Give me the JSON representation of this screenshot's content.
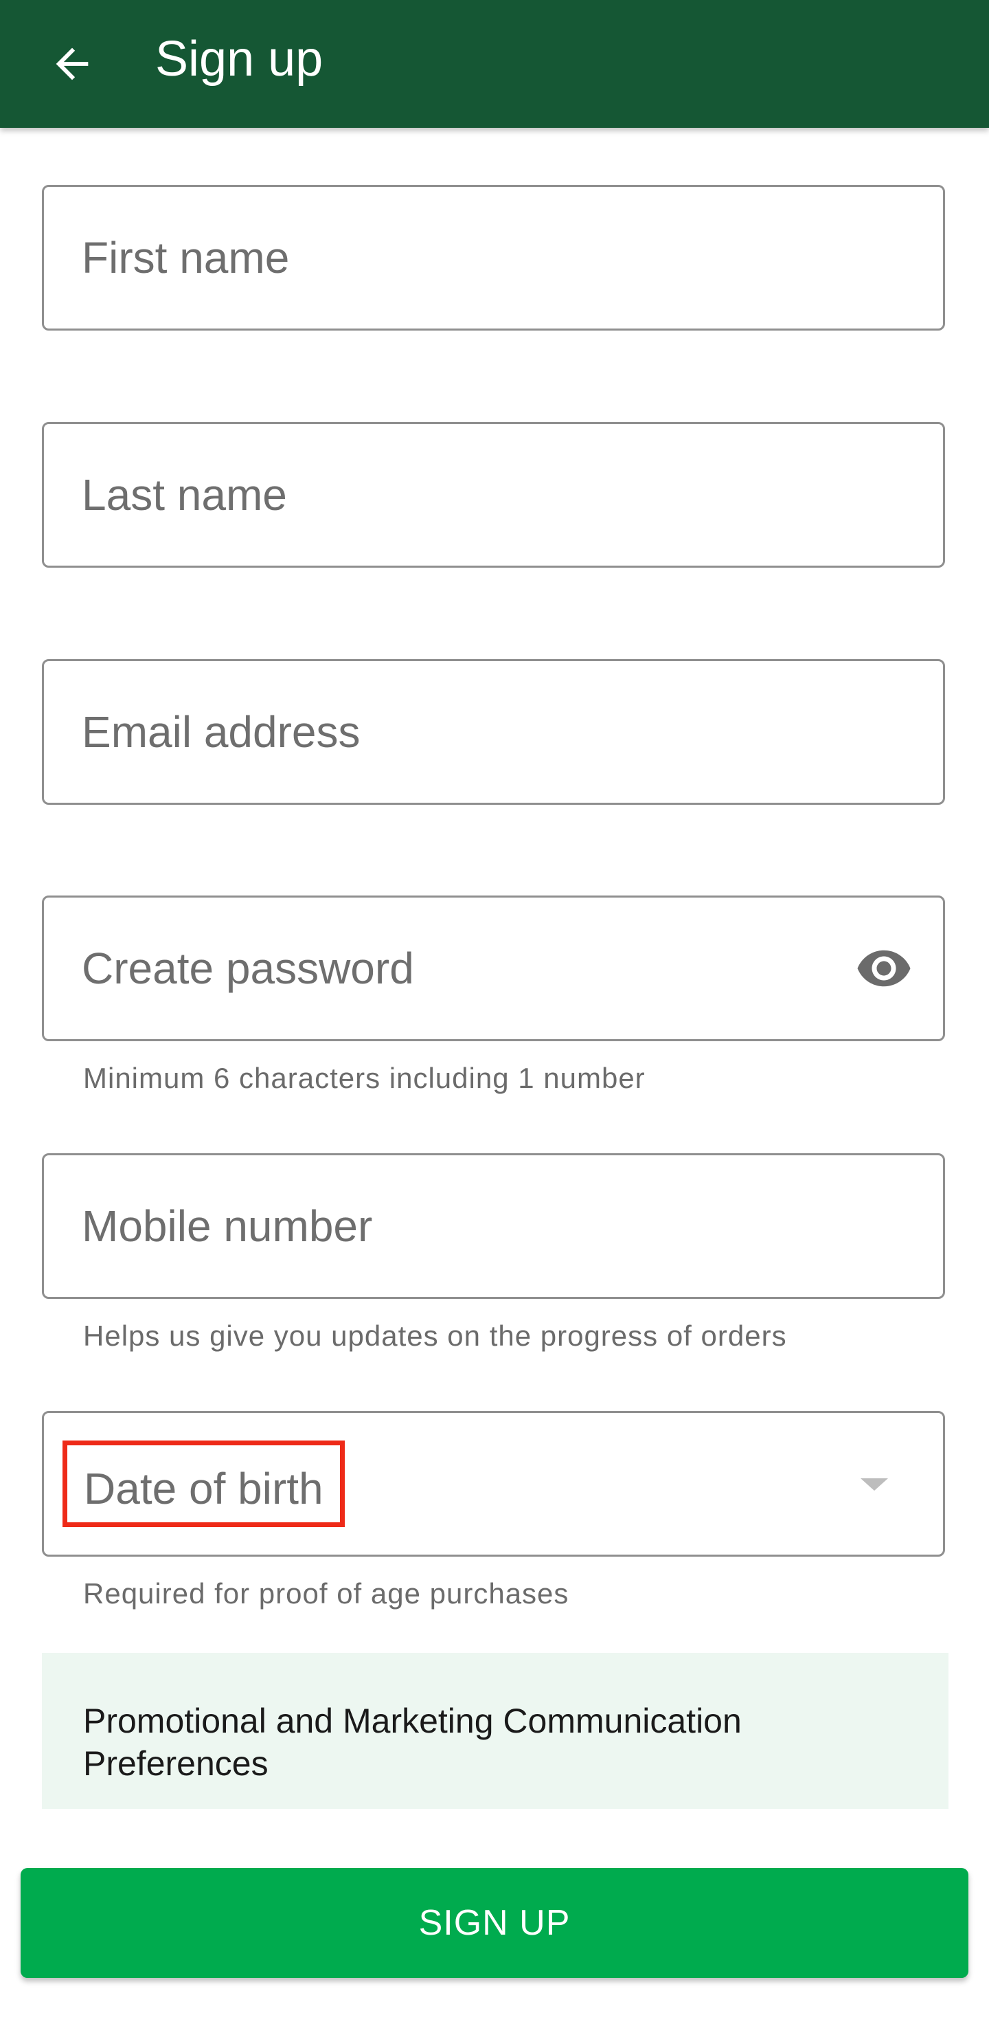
{
  "app_bar": {
    "title": "Sign up",
    "back_icon": "arrow-left-icon",
    "color": "#155734"
  },
  "form": {
    "first_name": {
      "placeholder": "First name",
      "value": ""
    },
    "last_name": {
      "placeholder": "Last name",
      "value": ""
    },
    "email": {
      "placeholder": "Email address",
      "value": ""
    },
    "password": {
      "placeholder": "Create password",
      "value": "",
      "helper": "Minimum 6 characters including 1 number",
      "toggle_icon": "eye-icon"
    },
    "mobile": {
      "placeholder": "Mobile number",
      "value": "",
      "helper": "Helps us give you updates on the progress of orders"
    },
    "dob": {
      "label": "Date of birth",
      "helper": "Required for proof of age purchases",
      "dropdown_icon": "caret-down-icon",
      "highlight_color": "#ee2a18"
    }
  },
  "promo": {
    "title": "Promotional and Marketing Communication Preferences",
    "background": "#edf7f1"
  },
  "actions": {
    "signup_label": "SIGN UP",
    "signup_color": "#00ab4e"
  }
}
